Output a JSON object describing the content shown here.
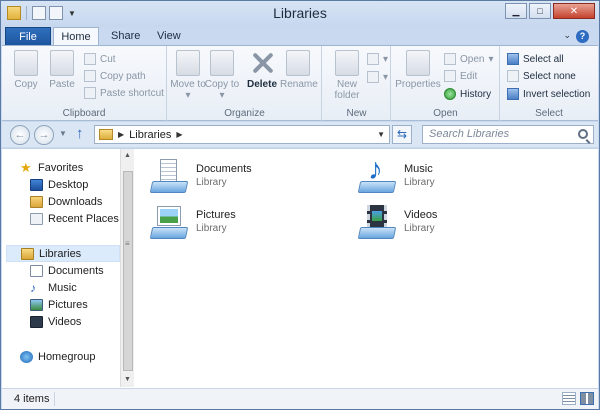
{
  "window": {
    "title": "Libraries"
  },
  "tabs": [
    {
      "label": "File"
    },
    {
      "label": "Home"
    },
    {
      "label": "Share"
    },
    {
      "label": "View"
    }
  ],
  "ribbon": {
    "clipboard": {
      "label": "Clipboard",
      "copy": "Copy",
      "paste": "Paste",
      "cut": "Cut",
      "copy_path": "Copy path",
      "paste_shortcut": "Paste shortcut"
    },
    "organize": {
      "label": "Organize",
      "move_to": "Move to",
      "copy_to": "Copy to",
      "delete": "Delete",
      "rename": "Rename"
    },
    "new": {
      "label": "New",
      "new_folder": "New folder"
    },
    "open": {
      "label": "Open",
      "properties": "Properties",
      "open": "Open",
      "edit": "Edit",
      "history": "History"
    },
    "select": {
      "label": "Select",
      "select_all": "Select all",
      "select_none": "Select none",
      "invert_selection": "Invert selection"
    }
  },
  "address": {
    "path": "Libraries",
    "search_placeholder": "Search Libraries"
  },
  "nav": {
    "favorites": "Favorites",
    "favorites_items": [
      "Desktop",
      "Downloads",
      "Recent Places"
    ],
    "libraries": "Libraries",
    "libraries_items": [
      "Documents",
      "Music",
      "Pictures",
      "Videos"
    ],
    "homegroup": "Homegroup"
  },
  "content": {
    "items": [
      {
        "name": "Documents",
        "type": "Library"
      },
      {
        "name": "Music",
        "type": "Library"
      },
      {
        "name": "Pictures",
        "type": "Library"
      },
      {
        "name": "Videos",
        "type": "Library"
      }
    ]
  },
  "status": {
    "count": "4 items"
  }
}
